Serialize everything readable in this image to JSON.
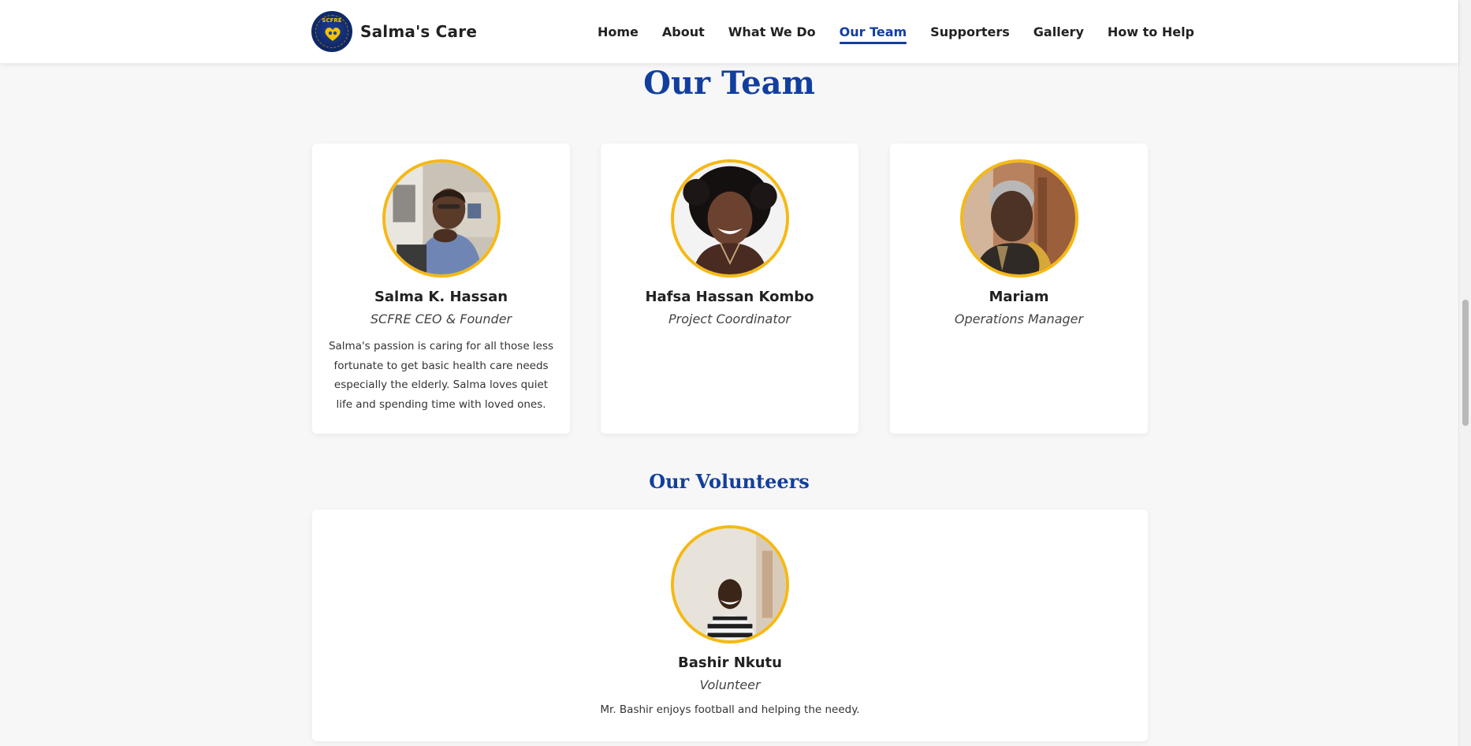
{
  "header": {
    "brand": "Salma's Care",
    "logo_text": "SCFRE",
    "nav": [
      "Home",
      "About",
      "What We Do",
      "Our Team",
      "Supporters",
      "Gallery",
      "How to Help"
    ],
    "active_nav": "Our Team"
  },
  "page": {
    "title": "Our Team",
    "volunteers_title": "Our Volunteers"
  },
  "team": [
    {
      "name": "Salma K. Hassan",
      "role": "SCFRE CEO & Founder",
      "bio": "Salma's passion is caring for all those less fortunate to get basic health care needs especially the elderly. Salma loves quiet life and spending time with loved ones."
    },
    {
      "name": "Hafsa Hassan Kombo",
      "role": "Project Coordinator",
      "bio": ""
    },
    {
      "name": "Mariam",
      "role": "Operations Manager",
      "bio": ""
    }
  ],
  "volunteers": [
    {
      "name": "Bashir Nkutu",
      "role": "Volunteer",
      "bio": "Mr. Bashir enjoys football and helping the needy."
    }
  ],
  "colors": {
    "accent": "#123f9e",
    "avatar_border": "#f5b914",
    "background": "#f7f7f7"
  }
}
